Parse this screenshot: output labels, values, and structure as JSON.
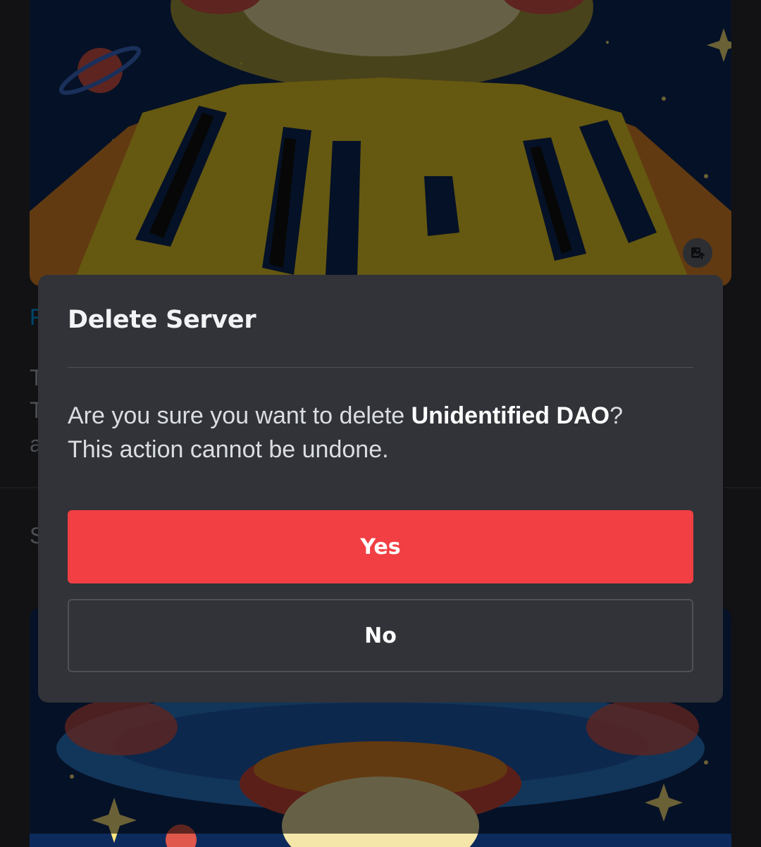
{
  "background": {
    "peek_letters": {
      "link": "F",
      "line1": "T",
      "line2": "T",
      "line3": "a",
      "section": "S"
    },
    "upload_icon": "image-upload-icon"
  },
  "dialog": {
    "title": "Delete Server",
    "message_prefix": "Are you sure you want to delete ",
    "server_name": "Unidentified DAO",
    "message_suffix": "?",
    "message_line2": "This action cannot be undone.",
    "confirm_label": "Yes",
    "cancel_label": "No"
  },
  "colors": {
    "dialog_bg": "#313338",
    "danger": "#f23f43",
    "title_text": "#f2f3f5",
    "body_text": "#dbdee1",
    "link": "#00a8fc"
  }
}
